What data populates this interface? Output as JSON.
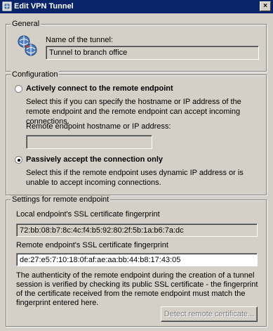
{
  "window": {
    "title": "Edit VPN Tunnel",
    "close_glyph": "×"
  },
  "general": {
    "group_label": "General",
    "name_label": "Name of the tunnel:",
    "name_value": "Tunnel to branch office",
    "icon": "vpn-tunnel-icon"
  },
  "configuration": {
    "group_label": "Configuration",
    "option_active_label": "Actively connect to the remote endpoint",
    "option_active_desc": "Select this if you can specify the hostname or IP address of the remote endpoint and the remote endpoint can accept incoming connections.",
    "hostname_label": "Remote endpoint hostname or IP address:",
    "hostname_value": "",
    "option_passive_label": "Passively accept the connection only",
    "option_passive_desc": "Select this if the remote endpoint uses dynamic IP address or is unable to accept incoming connections.",
    "selected": "passive"
  },
  "settings": {
    "group_label": "Settings for remote endpoint",
    "local_label": "Local endpoint's SSL certificate fingerprint",
    "local_value": "72:bb:08:b7:8c:4c:f4:b5:92:80:2f:5b:1a:b6:7a:dc",
    "remote_label": "Remote endpoint's SSL certificate fingerprint",
    "remote_value": "de:27:e5:7:10:18:0f:af:ae:aa:bb:44:b8:17:43:05",
    "note": "The authenticity of the remote endpoint during the creation of a tunnel session is verified by checking its public SSL certificate - the fingerprint of the certificate received from the remote endpoint must match the fingerprint entered here.",
    "detect_button": "Detect remote certificate..."
  }
}
